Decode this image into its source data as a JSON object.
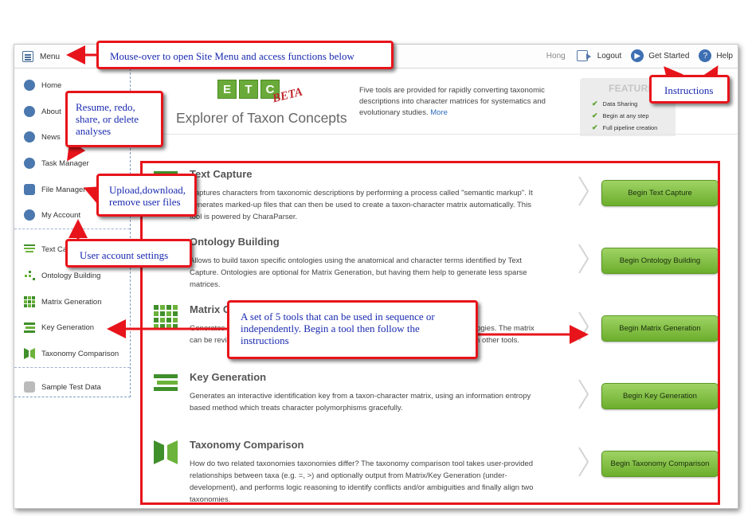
{
  "topbar": {
    "menu_label": "Menu",
    "user": "Hong",
    "logout_label": "Logout",
    "get_started_label": "Get Started",
    "help_label": "Help"
  },
  "sidebar": {
    "items": [
      {
        "label": "Home",
        "icon": "home-icon"
      },
      {
        "label": "About",
        "icon": "info-icon"
      },
      {
        "label": "News",
        "icon": "news-icon"
      },
      {
        "label": "Task Manager",
        "icon": "check-icon"
      },
      {
        "label": "File Manager",
        "icon": "file-icon"
      },
      {
        "label": "My Account",
        "icon": "gear-icon"
      }
    ],
    "tools": [
      {
        "label": "Text Capture",
        "icon": "text-capture-icon"
      },
      {
        "label": "Ontology Building",
        "icon": "ontology-icon"
      },
      {
        "label": "Matrix Generation",
        "icon": "matrix-icon"
      },
      {
        "label": "Key Generation",
        "icon": "key-icon"
      },
      {
        "label": "Taxonomy Comparison",
        "icon": "taxonomy-icon"
      }
    ],
    "sample": {
      "label": "Sample Test Data",
      "icon": "database-icon"
    }
  },
  "header": {
    "logo_letters": [
      "E",
      "T",
      "C"
    ],
    "logo_beta": "BETA",
    "logo_text": "Explorer of Taxon Concepts",
    "intro": "Five tools are provided for rapidly converting taxonomic descriptions into character matrices for systematics and evolutionary studies.",
    "more_link": "More",
    "features_title": "FEATURES",
    "features": [
      "Data Sharing",
      "Begin at any step",
      "Full pipeline creation"
    ]
  },
  "tools": [
    {
      "title": "Text Capture",
      "desc": "Captures characters from taxonomic descriptions by performing a process called \"semantic markup\". It generates marked-up files that can then be used to create a taxon-character matrix automatically. This tool is powered by CharaParser.",
      "button": "Begin Text Capture"
    },
    {
      "title": "Ontology Building",
      "desc": "Allows to build taxon specific ontologies using the anatomical and character terms identified by Text Capture. Ontologies are optional for Matrix Generation, but having them help to generate less sparse matrices.",
      "button": "Begin Ontology Building"
    },
    {
      "title": "Matrix Generation",
      "desc": "Generates a taxon-character matrix from marked-up taxonomic descriptions and ontologies. The matrix can be reviewed and edited in a user-friendly interface, and downloaded and used with other tools.",
      "button": "Begin Matrix Generation"
    },
    {
      "title": "Key Generation",
      "desc": "Generates an interactive identification key from a taxon-character matrix, using an information entropy based method which treats character polymorphisms gracefully.",
      "button": "Begin Key Generation"
    },
    {
      "title": "Taxonomy Comparison",
      "desc": "How do two related taxonomies taxonomies differ? The taxonomy comparison tool takes user-provided relationships between taxa (e.g. =, >) and optionally output from Matrix/Key Generation (under-development), and performs logic reasoning to identify conflicts and/or ambiguities and finally align two taxonomies.",
      "button": "Begin Taxonomy Comparison"
    }
  ],
  "annotations": {
    "menu": "Mouse-over to open Site Menu and access functions below",
    "task_manager": "Resume, redo, share, or delete analyses",
    "file_manager": "Upload,download, remove user files",
    "account": "User account settings",
    "instructions": "Instructions",
    "tools": "A set of 5 tools that can be used in sequence or independently. Begin a tool then follow the instructions"
  },
  "colors": {
    "accent_green": "#6cae2c",
    "annotation_red": "#e8141b",
    "annotation_text": "#1a2ab0",
    "nav_blue": "#4b78ae"
  }
}
